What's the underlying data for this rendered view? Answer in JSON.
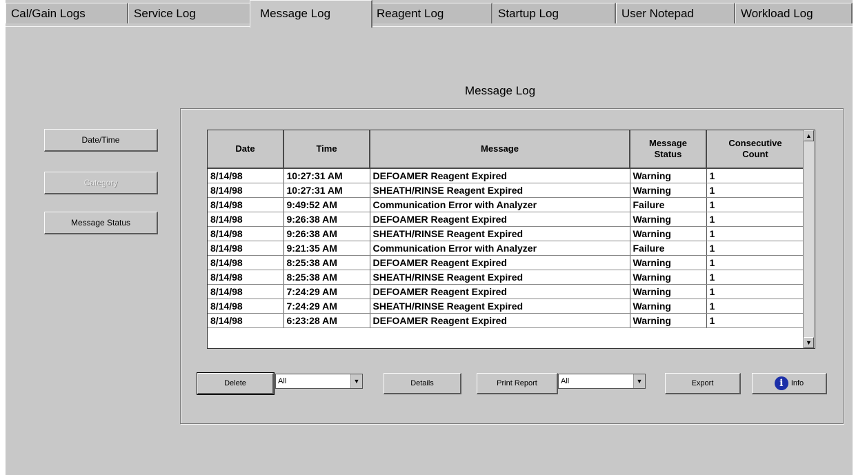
{
  "tabs": [
    {
      "label": "Cal/Gain Logs"
    },
    {
      "label": "Service Log"
    },
    {
      "label": "Message Log"
    },
    {
      "label": "Reagent Log"
    },
    {
      "label": "Startup Log"
    },
    {
      "label": "User Notepad"
    },
    {
      "label": "Workload Log"
    }
  ],
  "title": "Message Log",
  "sort_buttons": {
    "datetime": "Date/Time",
    "category": "Category",
    "message_status": "Message Status"
  },
  "grid": {
    "columns": [
      "Date",
      "Time",
      "Message",
      "Message Status",
      "Consecutive Count"
    ],
    "rows": [
      [
        "8/14/98",
        "10:27:31 AM",
        "DEFOAMER Reagent Expired",
        "Warning",
        "1"
      ],
      [
        "8/14/98",
        "10:27:31 AM",
        "SHEATH/RINSE Reagent Expired",
        "Warning",
        "1"
      ],
      [
        "8/14/98",
        "9:49:52 AM",
        "Communication Error with Analyzer",
        "Failure",
        "1"
      ],
      [
        "8/14/98",
        "9:26:38 AM",
        "DEFOAMER Reagent Expired",
        "Warning",
        "1"
      ],
      [
        "8/14/98",
        "9:26:38 AM",
        "SHEATH/RINSE Reagent Expired",
        "Warning",
        "1"
      ],
      [
        "8/14/98",
        "9:21:35 AM",
        "Communication Error with Analyzer",
        "Failure",
        "1"
      ],
      [
        "8/14/98",
        "8:25:38 AM",
        "DEFOAMER Reagent Expired",
        "Warning",
        "1"
      ],
      [
        "8/14/98",
        "8:25:38 AM",
        "SHEATH/RINSE Reagent Expired",
        "Warning",
        "1"
      ],
      [
        "8/14/98",
        "7:24:29 AM",
        "DEFOAMER Reagent Expired",
        "Warning",
        "1"
      ],
      [
        "8/14/98",
        "7:24:29 AM",
        "SHEATH/RINSE Reagent Expired",
        "Warning",
        "1"
      ],
      [
        "8/14/98",
        "6:23:28 AM",
        "DEFOAMER Reagent Expired",
        "Warning",
        "1"
      ]
    ]
  },
  "footer": {
    "delete_label": "Delete",
    "delete_filter": "All",
    "details_label": "Details",
    "print_label": "Print Report",
    "print_filter": "All",
    "export_label": "Export",
    "info_label": "Info"
  }
}
